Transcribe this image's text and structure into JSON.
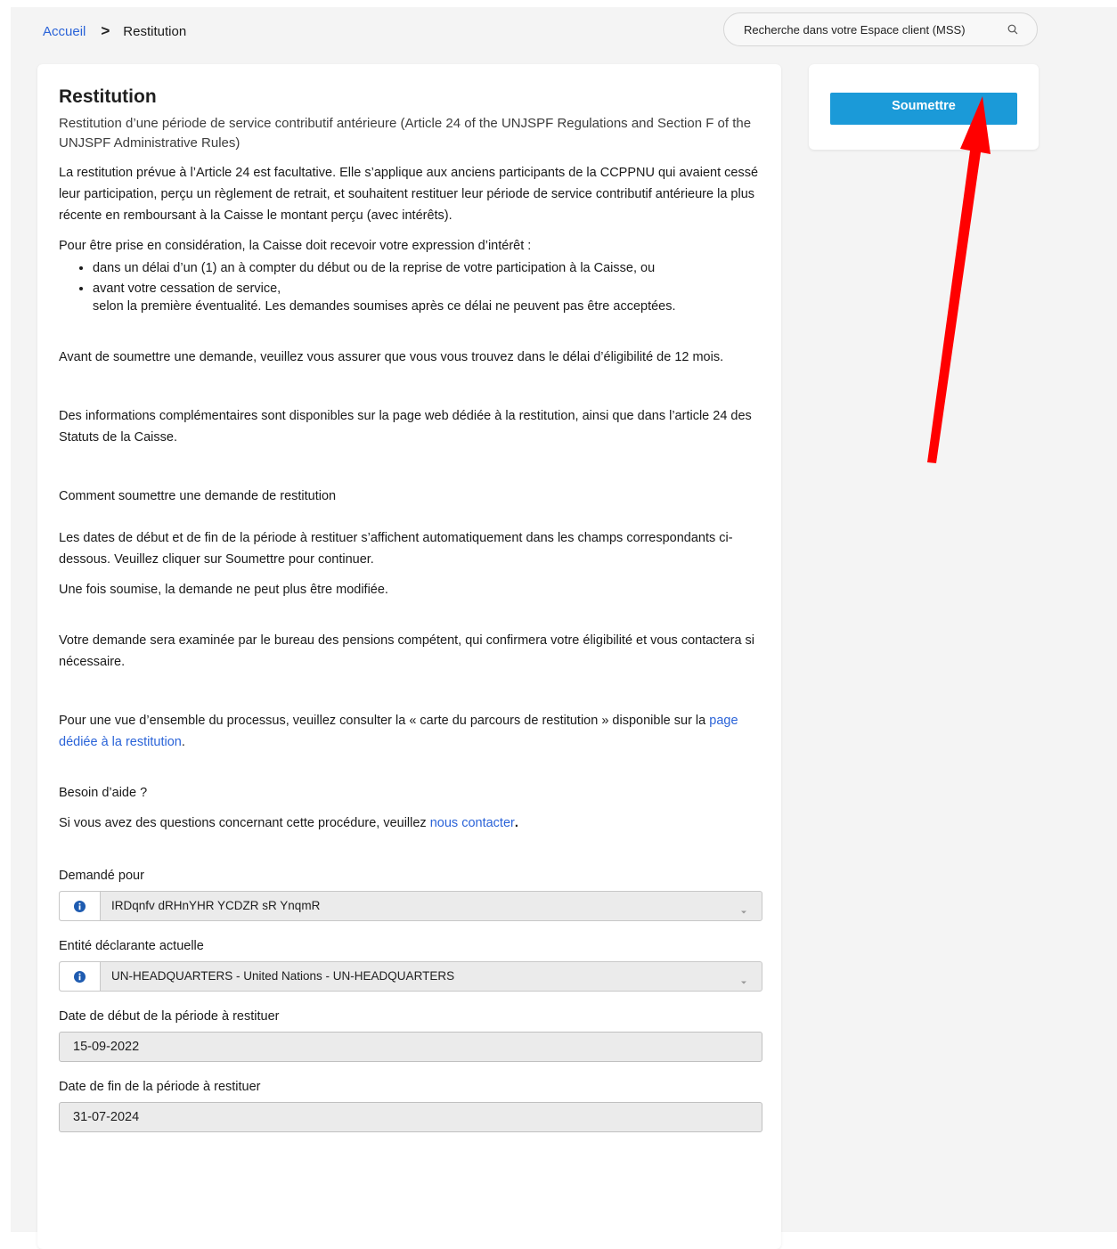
{
  "breadcrumb": {
    "home": "Accueil",
    "current": "Restitution"
  },
  "search": {
    "placeholder": "Recherche dans votre Espace client (MSS)"
  },
  "page": {
    "title": "Restitution",
    "subtitle": "Restitution d’une période de service contributif antérieure (Article 24 of the UNJSPF Regulations and Section F of the UNJSPF Administrative Rules)",
    "p1": "La restitution prévue à l’Article 24 est facultative. Elle s’applique aux anciens participants de la CCPPNU qui avaient cessé leur participation, perçu un règlement de retrait, et souhaitent restituer leur période de service contributif antérieure la plus récente en remboursant à la Caisse le montant perçu (avec intérêts).",
    "p2": "Pour être prise en considération, la Caisse doit recevoir votre expression d’intérêt :",
    "bullets": [
      "dans un délai d’un (1) an à compter du début ou de la reprise de votre participation à la Caisse, ou",
      "avant votre cessation de service,"
    ],
    "bullets_after": "selon la première éventualité. Les demandes soumises après ce délai ne peuvent pas être acceptées.",
    "p3": "Avant de soumettre une demande, veuillez vous assurer que vous vous trouvez dans le délai d’éligibilité de 12 mois.",
    "p4": "Des informations complémentaires sont disponibles sur la page web dédiée à la restitution, ainsi que dans l’article 24 des Statuts de la Caisse.",
    "p5": "Comment soumettre une demande de restitution",
    "p6": "Les dates de début et de fin de la période à restituer s’affichent automatiquement dans les champs correspondants ci-dessous. Veuillez cliquer sur Soumettre pour continuer.",
    "p7": "Une fois soumise, la demande ne peut plus être modifiée.",
    "p8": "Votre demande sera examinée par le bureau des pensions compétent, qui confirmera votre éligibilité et vous contactera si nécessaire.",
    "p9_text": "Pour une vue d’ensemble du processus, veuillez consulter la « carte du parcours de restitution » disponible sur la ",
    "p9_link": "page dédiée à la restitution",
    "p9_end": ".",
    "p10": "Besoin d’aide ?",
    "p11_text": "Si vous avez des questions concernant cette procédure, veuillez ",
    "p11_link": "nous contacter",
    "p11_end": "."
  },
  "form": {
    "requested_for": {
      "label": "Demandé pour",
      "value": "IRDqnfv dRHnYHR YCDZR sR YnqmR"
    },
    "reporting_entity": {
      "label": "Entité déclarante actuelle",
      "value": "UN-HEADQUARTERS - United Nations - UN-HEADQUARTERS"
    },
    "start_date": {
      "label": "Date de début de la période à restituer",
      "value": "15-09-2022"
    },
    "end_date": {
      "label": "Date de fin de la période à restituer",
      "value": "31-07-2024"
    }
  },
  "actions": {
    "submit": "Soumettre"
  },
  "colors": {
    "link": "#2a63d8",
    "primary_button": "#1b9ad8",
    "annotation_arrow": "#ff0000",
    "info_icon": "#1e5bb0"
  },
  "icons": {
    "search": "search-icon",
    "info": "info-icon",
    "dropdown": "chevron-down-icon",
    "annotation": "red-arrow-icon"
  }
}
